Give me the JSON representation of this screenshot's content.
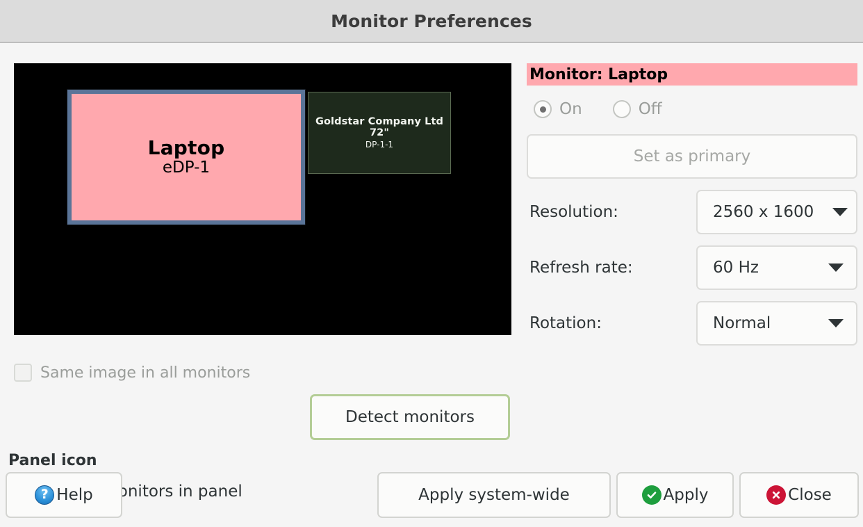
{
  "window": {
    "title": "Monitor Preferences"
  },
  "preview": {
    "monitors": [
      {
        "name": "Laptop",
        "id": "eDP-1",
        "selected": true,
        "color": "#ffa8ae",
        "border_color": "#5a7498"
      },
      {
        "name": "Goldstar Company Ltd 72\"",
        "id": "DP-1-1",
        "selected": false,
        "color": "#1e2a1c",
        "border_color": "#5b6b52"
      }
    ]
  },
  "options": {
    "same_image_label": "Same image in all monitors",
    "same_image_checked": false,
    "detect_label": "Detect monitors"
  },
  "panel_icon": {
    "heading": "Panel icon",
    "show_monitors_label": "Show monitors in panel",
    "show_monitors_checked": false
  },
  "monitor_settings": {
    "banner": "Monitor: Laptop",
    "banner_color": "#ffa8ae",
    "on_label": "On",
    "off_label": "Off",
    "power_selected": "On",
    "set_primary_label": "Set as primary",
    "resolution_label": "Resolution:",
    "resolution_value": "2560 x 1600",
    "refresh_label": "Refresh rate:",
    "refresh_value": "60 Hz",
    "rotation_label": "Rotation:",
    "rotation_value": "Normal"
  },
  "buttons": {
    "help": "Help",
    "apply_system_wide": "Apply system-wide",
    "apply": "Apply",
    "close": "Close"
  },
  "colors": {
    "accent_pink": "#ffa8ae",
    "focus_green": "#b4cd96",
    "apply_green": "#1e9e3e",
    "close_red": "#cc1436",
    "help_blue": "#2a8fd8"
  }
}
